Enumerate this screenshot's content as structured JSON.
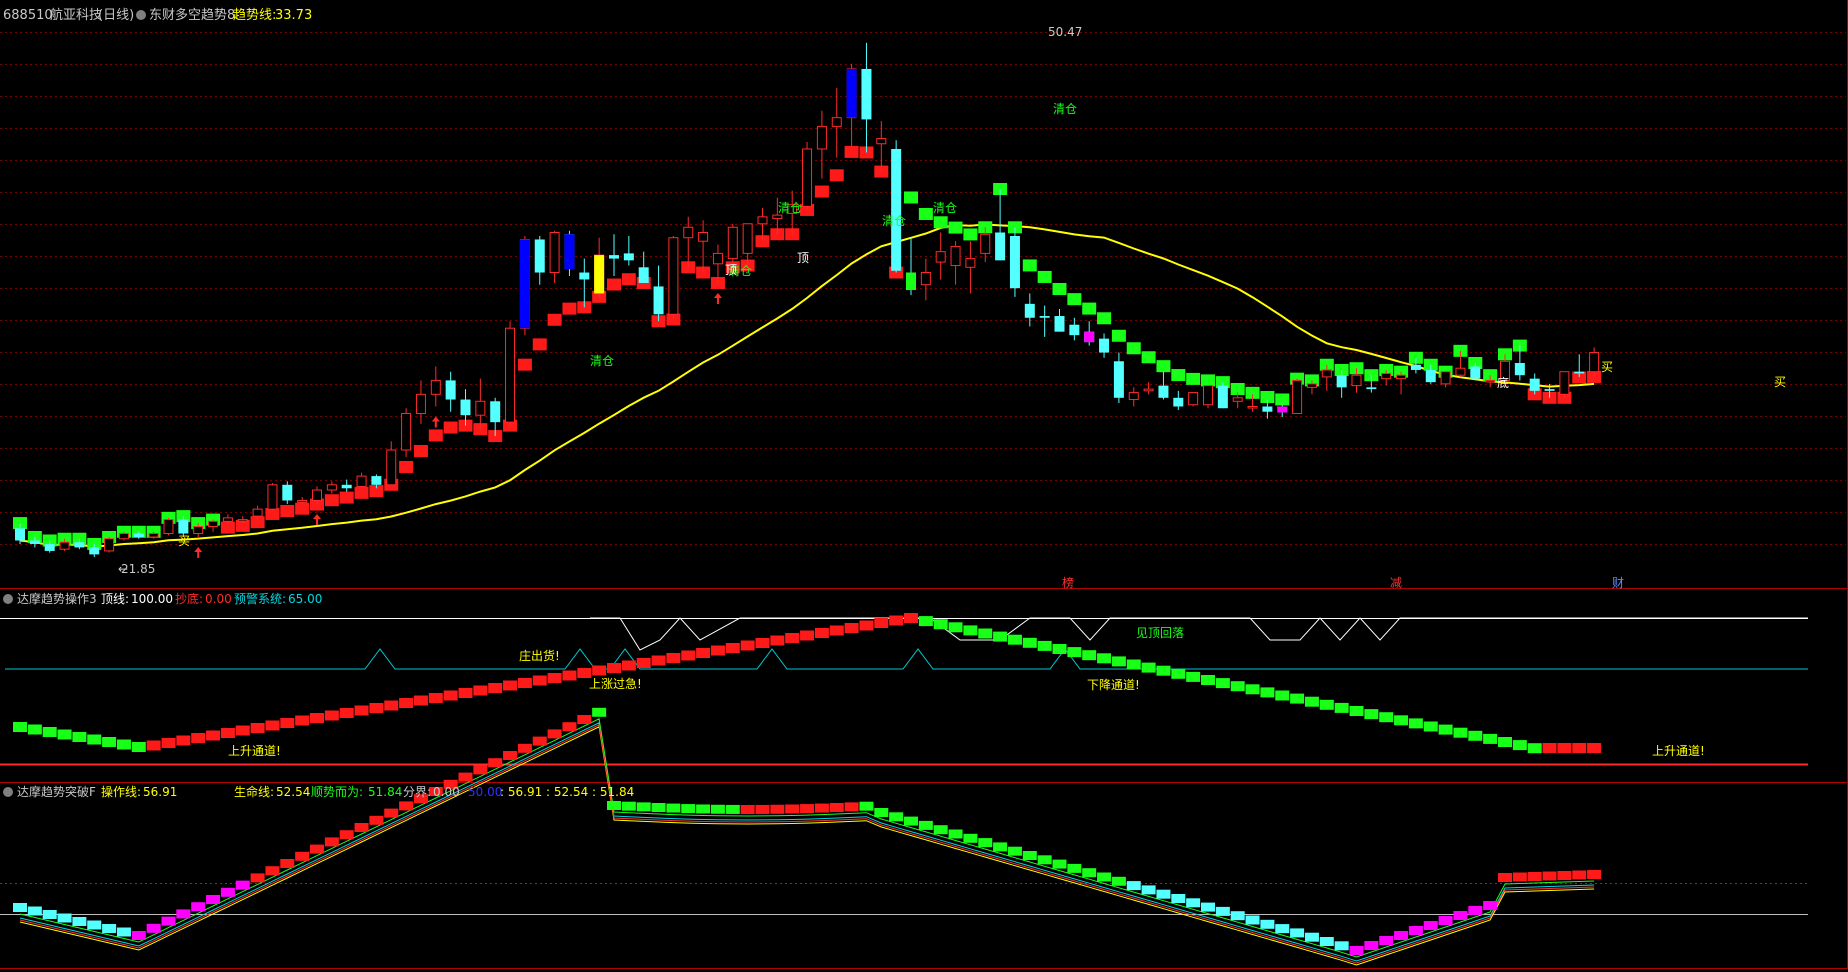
{
  "main_panel": {
    "stock_code": "688510",
    "stock_name": "航亚科技",
    "period": "(日线)",
    "indicator_name": "东财多空趋势8",
    "trend_label": "趋势线:",
    "trend_value": "33.73",
    "price_high": "50.47",
    "price_low": "21.85",
    "bottom_marks": [
      "榜",
      "减",
      "财"
    ],
    "signal_texts": {
      "clear": "清仓",
      "buy": "买",
      "top": "顶",
      "bottom": "底"
    }
  },
  "panel2": {
    "indicator_name": "达摩趋势操作3",
    "top_label": "顶线:",
    "top_value": "100.00",
    "bottom_label": "抄底:",
    "bottom_value": "0.00",
    "warn_label": "预警系统:",
    "warn_value": "65.00",
    "annotations": [
      "庄出货!",
      "上涨过急!",
      "见顶回落",
      "下降通道!",
      "上升通道!",
      "上升通道!"
    ]
  },
  "panel3": {
    "indicator_name": "达摩趋势突破F",
    "op_label": "操作线:",
    "op_value": "56.91",
    "life_label": "生命线:",
    "life_value": "52.54",
    "trend_label": "顺势而为:",
    "trend_value": "51.84",
    "split_label": "分界:",
    "split_value": "0.00",
    "v50": "50.00",
    "v_op": ": 56.91",
    "v_life": ": 52.54",
    "v_trend": ": 51.84"
  },
  "colors": {
    "bg": "#000000",
    "up": "#ff2a2a",
    "down": "#54ffff",
    "trend_up": "#ff1a1a",
    "trend_down": "#18ff18",
    "ma": "#ffff00",
    "grid": "#7a0000",
    "magenta": "#ff00ff",
    "blue": "#0000ff",
    "yellow": "#ffff00",
    "white": "#ffffff",
    "cyan_line": "#00c8d0"
  },
  "chart_data": {
    "type": "candlestick",
    "price_range": [
      21.85,
      50.47
    ],
    "series": [
      {
        "name": "K线",
        "values": [
          [
            23.5,
            23.8,
            22.6,
            22.8
          ],
          [
            22.8,
            23.0,
            22.4,
            22.6
          ],
          [
            22.6,
            22.8,
            22.1,
            22.2
          ],
          [
            22.3,
            22.9,
            22.2,
            22.7
          ],
          [
            22.7,
            22.9,
            22.3,
            22.4
          ],
          [
            22.4,
            22.6,
            21.85,
            22.0
          ],
          [
            22.2,
            23.0,
            22.1,
            22.9
          ],
          [
            22.9,
            23.3,
            22.8,
            23.2
          ],
          [
            23.2,
            23.3,
            22.9,
            23.0
          ],
          [
            23.0,
            23.3,
            22.9,
            23.2
          ],
          [
            23.2,
            24.1,
            23.1,
            24.0
          ],
          [
            24.0,
            24.2,
            23.0,
            23.2
          ],
          [
            23.2,
            23.8,
            23.0,
            23.6
          ],
          [
            23.6,
            24.0,
            23.3,
            23.9
          ],
          [
            23.9,
            24.3,
            23.7,
            24.1
          ],
          [
            24.0,
            24.2,
            23.8,
            24.0
          ],
          [
            24.2,
            24.8,
            24.0,
            24.6
          ],
          [
            24.6,
            26.1,
            24.5,
            26.0
          ],
          [
            26.0,
            26.2,
            24.9,
            25.1
          ],
          [
            25.0,
            25.3,
            24.9,
            25.1
          ],
          [
            25.1,
            25.9,
            24.9,
            25.7
          ],
          [
            25.7,
            26.2,
            25.5,
            26.0
          ],
          [
            26.0,
            26.3,
            25.6,
            25.8
          ],
          [
            25.9,
            26.7,
            25.8,
            26.5
          ],
          [
            26.5,
            26.6,
            25.8,
            26.0
          ],
          [
            26.0,
            28.5,
            26.0,
            28.0
          ],
          [
            28.0,
            30.4,
            27.6,
            30.1
          ],
          [
            30.1,
            32.0,
            29.5,
            31.2
          ],
          [
            31.2,
            32.8,
            30.5,
            32.0
          ],
          [
            32.0,
            32.5,
            30.2,
            30.9
          ],
          [
            30.9,
            31.5,
            29.4,
            30.0
          ],
          [
            30.0,
            32.1,
            29.2,
            30.8
          ],
          [
            30.8,
            31.0,
            28.8,
            29.6
          ],
          [
            29.6,
            35.4,
            29.4,
            35.0
          ],
          [
            35.0,
            40.3,
            34.6,
            40.1
          ],
          [
            40.1,
            40.3,
            37.5,
            38.2
          ],
          [
            38.2,
            40.6,
            37.6,
            40.5
          ],
          [
            40.4,
            40.6,
            38.0,
            38.4
          ],
          [
            38.2,
            39.0,
            36.2,
            37.8
          ],
          [
            37.0,
            40.2,
            36.8,
            39.2
          ],
          [
            39.2,
            40.4,
            38.0,
            39.0
          ],
          [
            39.3,
            40.3,
            38.6,
            38.9
          ],
          [
            38.5,
            39.4,
            37.6,
            37.6
          ],
          [
            37.4,
            38.6,
            35.4,
            35.8
          ],
          [
            35.8,
            40.3,
            35.5,
            40.2
          ],
          [
            40.2,
            41.4,
            38.5,
            40.8
          ],
          [
            40.0,
            41.2,
            38.2,
            40.5
          ],
          [
            38.7,
            39.8,
            37.6,
            39.3
          ],
          [
            39.0,
            41.0,
            38.5,
            40.8
          ],
          [
            39.3,
            41.0,
            38.6,
            41.0
          ],
          [
            41.0,
            41.9,
            40.0,
            41.4
          ],
          [
            41.3,
            42.5,
            40.4,
            41.5
          ],
          [
            41.6,
            42.9,
            40.4,
            42.1
          ],
          [
            42.0,
            45.7,
            41.8,
            45.3
          ],
          [
            45.3,
            47.5,
            43.6,
            46.6
          ],
          [
            46.6,
            48.8,
            44.8,
            47.1
          ],
          [
            47.1,
            50.2,
            45.4,
            49.9
          ],
          [
            49.9,
            51.4,
            45.1,
            47.0
          ],
          [
            45.6,
            46.9,
            44.0,
            45.9
          ],
          [
            45.3,
            45.8,
            38.2,
            38.3
          ],
          [
            38.2,
            40.2,
            36.9,
            37.2
          ],
          [
            37.5,
            39.0,
            36.6,
            38.2
          ],
          [
            38.8,
            40.5,
            37.8,
            39.4
          ],
          [
            38.6,
            40.0,
            37.5,
            39.7
          ],
          [
            38.5,
            40.0,
            37.0,
            39.0
          ],
          [
            39.3,
            40.8,
            38.8,
            40.4
          ],
          [
            40.5,
            43.0,
            38.9,
            38.9
          ],
          [
            40.3,
            40.8,
            36.8,
            37.3
          ],
          [
            36.4,
            37.0,
            35.1,
            35.6
          ],
          [
            35.7,
            36.3,
            34.5,
            35.6
          ],
          [
            35.7,
            36.1,
            34.8,
            34.8
          ],
          [
            35.2,
            35.6,
            34.3,
            34.6
          ],
          [
            34.8,
            35.4,
            34.0,
            34.2
          ],
          [
            34.4,
            34.7,
            33.3,
            33.6
          ],
          [
            33.1,
            33.6,
            30.7,
            31.0
          ],
          [
            30.9,
            31.6,
            30.5,
            31.3
          ],
          [
            31.4,
            31.9,
            31.2,
            31.5
          ],
          [
            31.7,
            32.5,
            30.9,
            31.0
          ],
          [
            31.0,
            31.4,
            30.3,
            30.5
          ],
          [
            30.6,
            31.3,
            30.5,
            31.3
          ],
          [
            30.6,
            31.7,
            30.4,
            31.7
          ],
          [
            31.7,
            31.9,
            30.4,
            30.4
          ],
          [
            30.8,
            31.3,
            30.4,
            31.0
          ],
          [
            30.5,
            31.2,
            30.2,
            30.5
          ],
          [
            30.5,
            30.9,
            29.8,
            30.2
          ],
          [
            30.5,
            30.6,
            29.9,
            30.4
          ],
          [
            30.1,
            32.1,
            30.1,
            32.0
          ],
          [
            31.6,
            32.0,
            31.2,
            31.8
          ],
          [
            32.2,
            32.9,
            31.4,
            32.6
          ],
          [
            32.3,
            32.6,
            31.0,
            31.6
          ],
          [
            31.7,
            32.7,
            31.3,
            32.3
          ],
          [
            31.6,
            32.3,
            31.3,
            31.5
          ],
          [
            32.1,
            32.6,
            31.7,
            32.4
          ],
          [
            32.1,
            32.5,
            31.2,
            32.3
          ],
          [
            32.9,
            33.3,
            32.4,
            32.6
          ],
          [
            32.6,
            32.9,
            31.8,
            31.9
          ],
          [
            31.8,
            32.5,
            31.6,
            32.5
          ],
          [
            32.3,
            33.7,
            32.2,
            32.7
          ],
          [
            32.8,
            33.0,
            32.0,
            32.1
          ],
          [
            32.0,
            32.3,
            31.6,
            32.0
          ],
          [
            32.0,
            33.5,
            31.8,
            33.1
          ],
          [
            33.0,
            34.0,
            32.0,
            32.3
          ],
          [
            32.1,
            32.4,
            31.2,
            31.4
          ],
          [
            31.5,
            31.8,
            31.0,
            31.4
          ],
          [
            31.2,
            32.5,
            31.0,
            32.5
          ],
          [
            32.5,
            33.5,
            32.2,
            32.4
          ],
          [
            32.5,
            33.9,
            32.2,
            33.6
          ]
        ]
      }
    ]
  }
}
